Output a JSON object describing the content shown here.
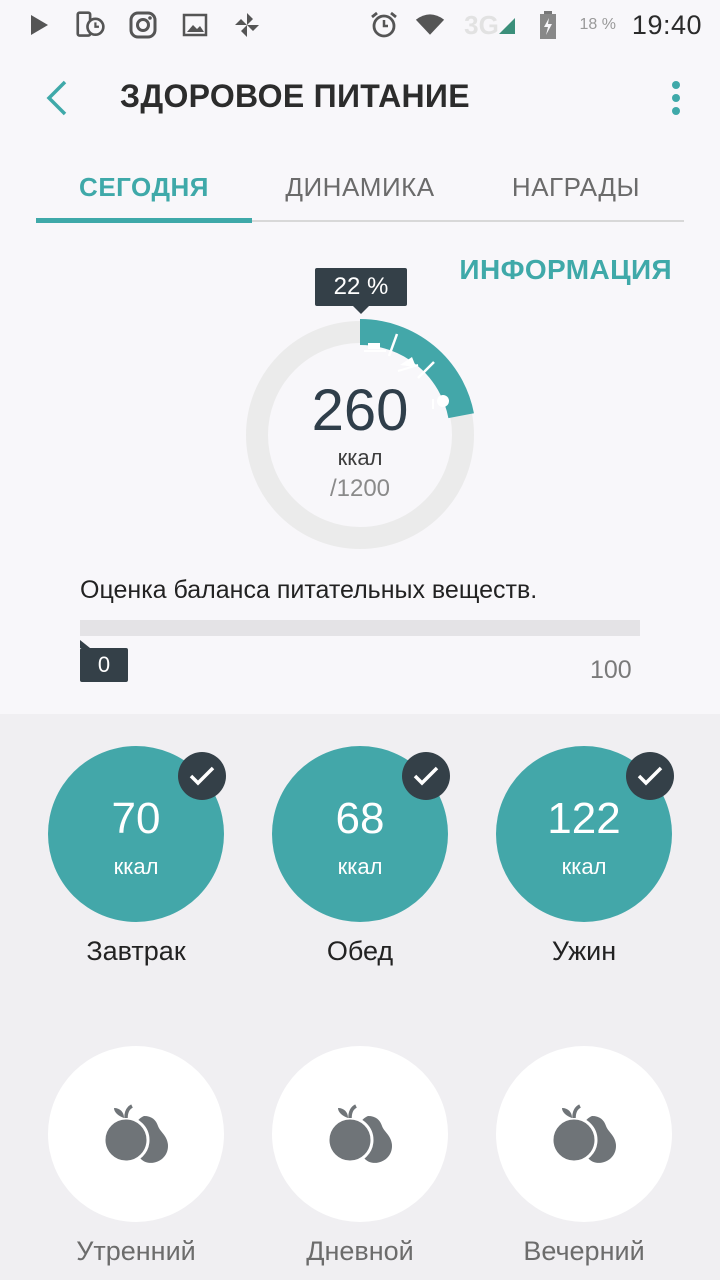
{
  "status_bar": {
    "time": "19:40",
    "network": "3G",
    "battery": "18 %"
  },
  "header": {
    "title": "ЗДОРОВОЕ ПИТАНИЕ"
  },
  "tabs": [
    {
      "label": "СЕГОДНЯ",
      "active": true
    },
    {
      "label": "ДИНАМИКА",
      "active": false
    },
    {
      "label": "НАГРАДЫ",
      "active": false
    }
  ],
  "info_link": "ИНФОРМАЦИЯ",
  "calories": {
    "value": "260",
    "unit": "ккал",
    "goal": "/1200",
    "percent_label": "22 %",
    "percent": 22
  },
  "balance": {
    "label": "Оценка баланса питательных веществ.",
    "value": "0",
    "max": "100"
  },
  "meals": [
    {
      "value": "70",
      "unit": "ккал",
      "label": "Завтрак",
      "checked": true
    },
    {
      "value": "68",
      "unit": "ккал",
      "label": "Обед",
      "checked": true
    },
    {
      "value": "122",
      "unit": "ккал",
      "label": "Ужин",
      "checked": true
    }
  ],
  "snacks": [
    {
      "label": "Утренний",
      "icon": "fruit-icon"
    },
    {
      "label": "Дневной",
      "icon": "fruit-icon"
    },
    {
      "label": "Вечерний",
      "icon": "fruit-icon"
    }
  ],
  "colors": {
    "accent": "#43a7a9",
    "dark": "#344048",
    "ring_bg": "#ebebeb"
  }
}
